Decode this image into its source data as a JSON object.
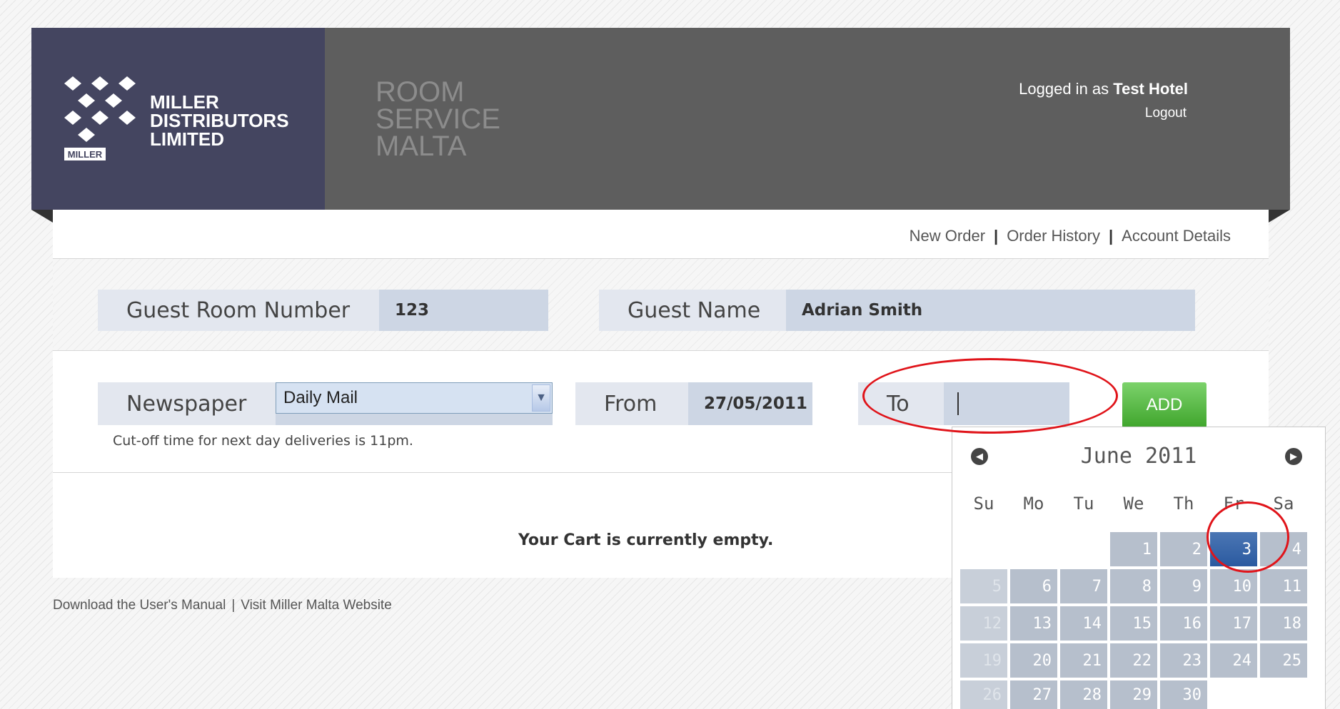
{
  "brand": {
    "logo_tag": "MILLER",
    "name_lines": [
      "MILLER",
      "DISTRIBUTORS",
      "LIMITED"
    ],
    "site_title_lines": [
      "ROOM",
      "SERVICE",
      "MALTA"
    ]
  },
  "user": {
    "prefix": "Logged in as",
    "name": "Test Hotel",
    "logout_label": "Logout"
  },
  "nav": {
    "items": [
      "New Order",
      "Order History",
      "Account Details"
    ],
    "separator": "|"
  },
  "guest": {
    "room_label": "Guest Room Number",
    "room_value": "123",
    "name_label": "Guest Name",
    "name_value": "Adrian Smith"
  },
  "order": {
    "newspaper_label": "Newspaper",
    "newspaper_selected": "Daily Mail",
    "from_label": "From",
    "from_value": "27/05/2011",
    "to_label": "To",
    "to_value": "",
    "add_label": "ADD",
    "cutoff_note": "Cut-off time for next day deliveries is 11pm."
  },
  "cart": {
    "message": "Your Cart is currently empty."
  },
  "footer": {
    "links": [
      "Download the User's Manual",
      "Visit Miller Malta Website"
    ],
    "separator": "|"
  },
  "datepicker": {
    "title": "June 2011",
    "weekdays": [
      "Su",
      "Mo",
      "Tu",
      "We",
      "Th",
      "Fr",
      "Sa"
    ],
    "weeks": [
      [
        null,
        null,
        null,
        "1",
        "2",
        "3",
        "4"
      ],
      [
        "5",
        "6",
        "7",
        "8",
        "9",
        "10",
        "11"
      ],
      [
        "12",
        "13",
        "14",
        "15",
        "16",
        "17",
        "18"
      ],
      [
        "19",
        "20",
        "21",
        "22",
        "23",
        "24",
        "25"
      ],
      [
        "26",
        "27",
        "28",
        "29",
        "30",
        null,
        null
      ]
    ],
    "selected": "3",
    "disabled": [
      "5",
      "12",
      "19",
      "26"
    ]
  },
  "colors": {
    "header_bg": "#5e5e5e",
    "logo_panel_bg": "#444560",
    "label_bg": "#e3e7ef",
    "value_bg": "#cdd6e4",
    "add_button": "#4fb33a",
    "selected_day": "#2b5aa0",
    "annotation": "#e0141a"
  }
}
